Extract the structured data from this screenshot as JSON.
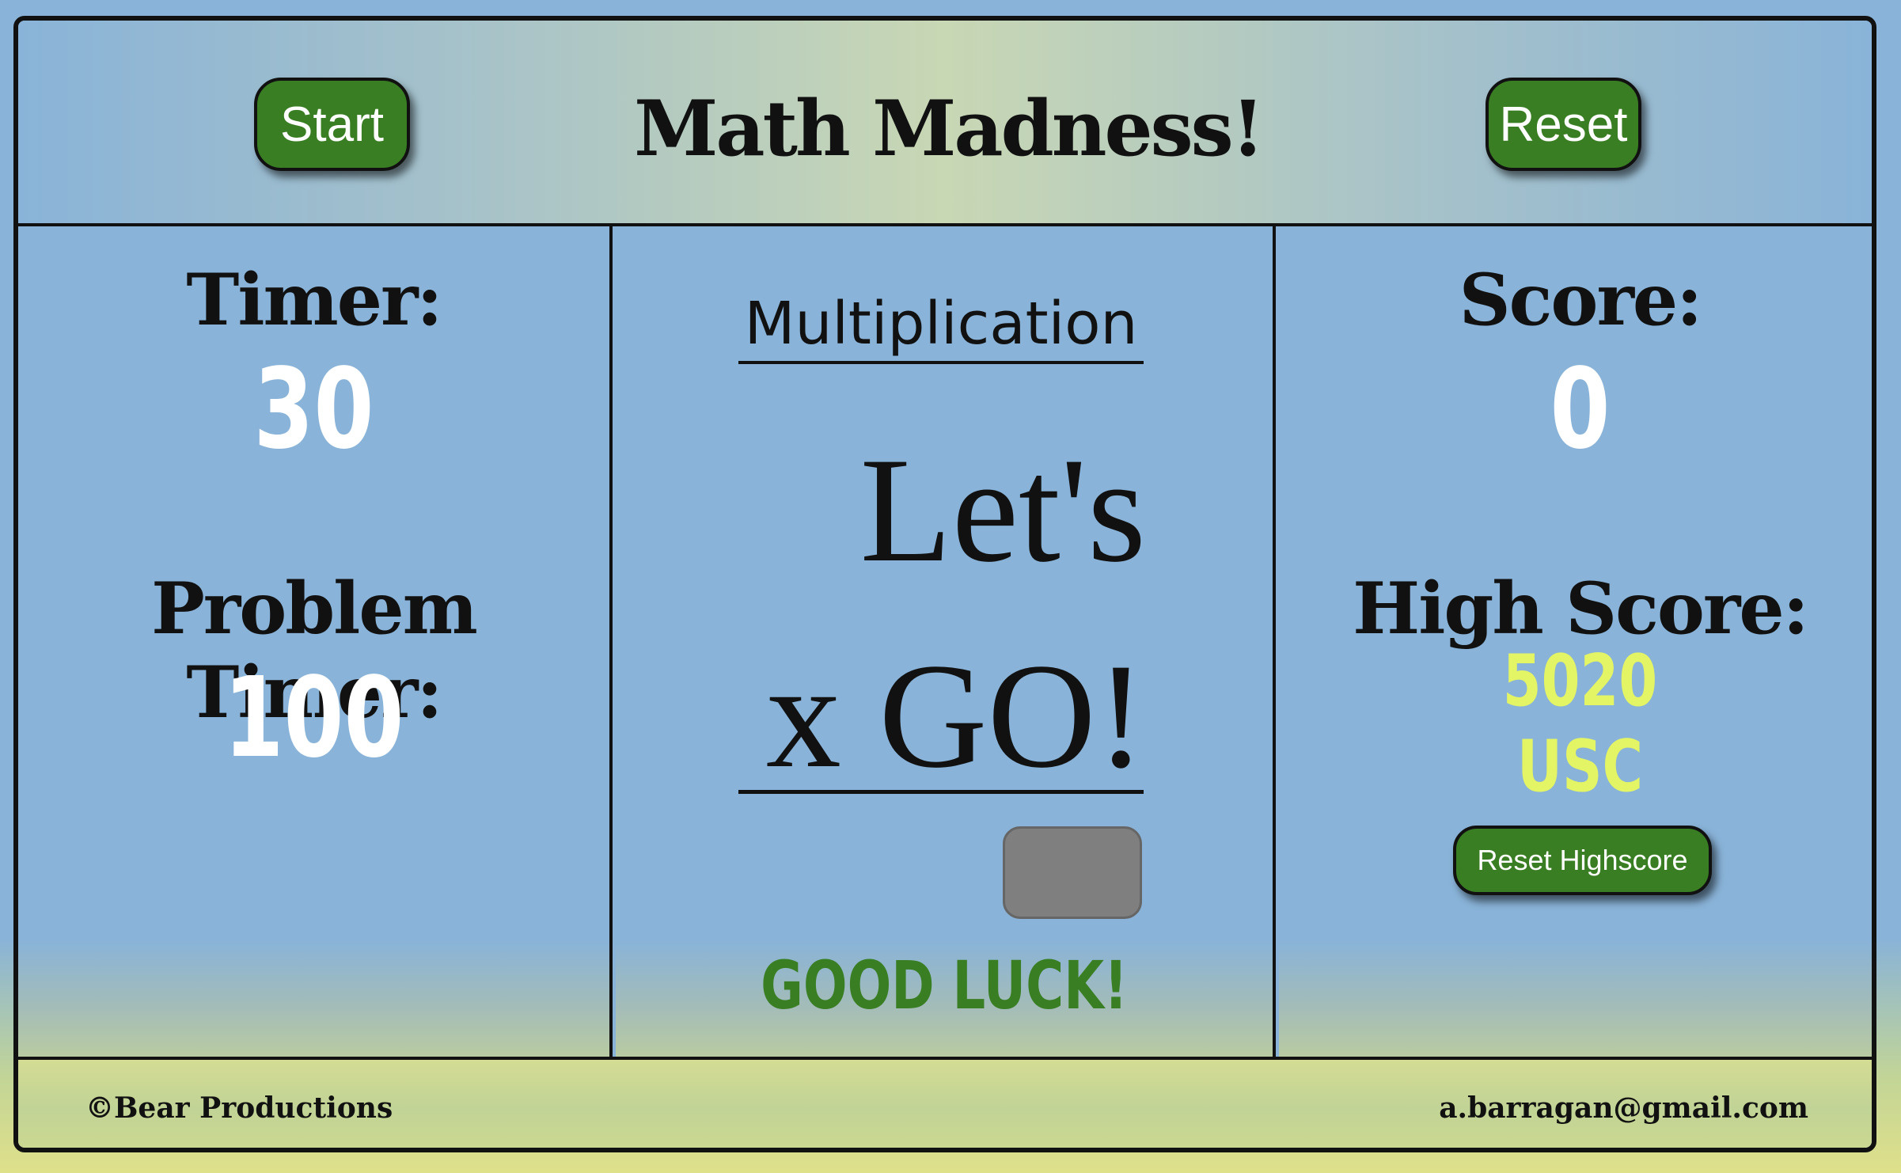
{
  "header": {
    "title": "Math Madness!",
    "start_label": "Start",
    "reset_label": "Reset"
  },
  "left": {
    "timer_label": "Timer:",
    "timer_value": "30",
    "problem_timer_label": "Problem Timer:",
    "problem_timer_value": "100"
  },
  "middle": {
    "operation": "Multiplication",
    "top_line": "Let's",
    "bottom_line": "x GO!",
    "answer_value": "",
    "status": "GOOD LUCK!"
  },
  "right": {
    "score_label": "Score:",
    "score_value": "0",
    "high_score_label": "High Score:",
    "high_score_value": "5020",
    "high_score_name": "USC",
    "reset_highscore_label": "Reset Highscore"
  },
  "footer": {
    "copyright": "©Bear Productions",
    "email": "a.barragan@gmail.com"
  },
  "colors": {
    "button_green": "#3a7e24",
    "panel_blue": "#89b3d8",
    "highscore_yellow": "#e3f564",
    "status_green": "#3a7e24"
  }
}
